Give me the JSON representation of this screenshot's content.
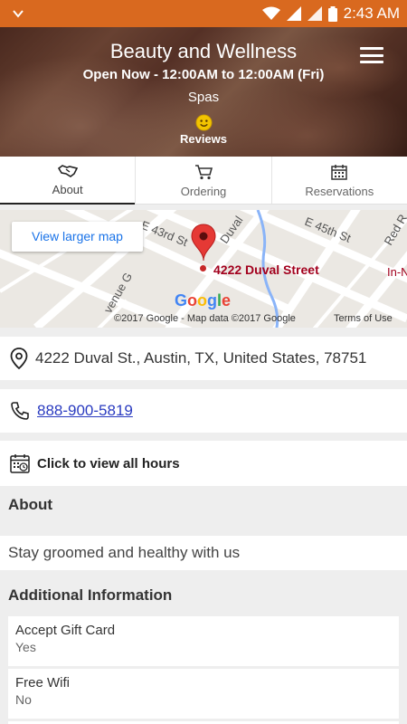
{
  "status_bar": {
    "time": "2:43 AM"
  },
  "header": {
    "title": "Beauty and Wellness",
    "hours": "Open Now - 12:00AM to 12:00AM (Fri)",
    "category": "Spas",
    "reviews_label": "Reviews"
  },
  "tabs": [
    {
      "label": "About",
      "icon": "handshake-icon",
      "active": true
    },
    {
      "label": "Ordering",
      "icon": "cart-icon",
      "active": false
    },
    {
      "label": "Reservations",
      "icon": "calendar-icon",
      "active": false
    }
  ],
  "map": {
    "view_larger_label": "View larger map",
    "pin_label": "4222 Duval Street",
    "google_logo": "Google",
    "copyright": "©2017 Google - Map data ©2017 Google",
    "terms": "Terms of Use",
    "street_labels": [
      "E 43rd St",
      "Duval",
      "E 45th St",
      "Red R",
      "In-N",
      "venue G"
    ]
  },
  "contact": {
    "address": "4222 Duval St., Austin, TX, United States, 78751",
    "phone": "888-900-5819",
    "hours_link": "Click to view all hours"
  },
  "about": {
    "heading": "About",
    "text": "Stay groomed and healthy with us"
  },
  "additional": {
    "heading": "Additional Information",
    "items": [
      {
        "label": "Accept Gift Card",
        "value": "Yes"
      },
      {
        "label": "Free Wifi",
        "value": "No"
      }
    ]
  },
  "colors": {
    "status_bar": "#d9691f",
    "link": "#2a3bc0",
    "map_pin": "#e53935",
    "map_label": "#a2001d"
  }
}
